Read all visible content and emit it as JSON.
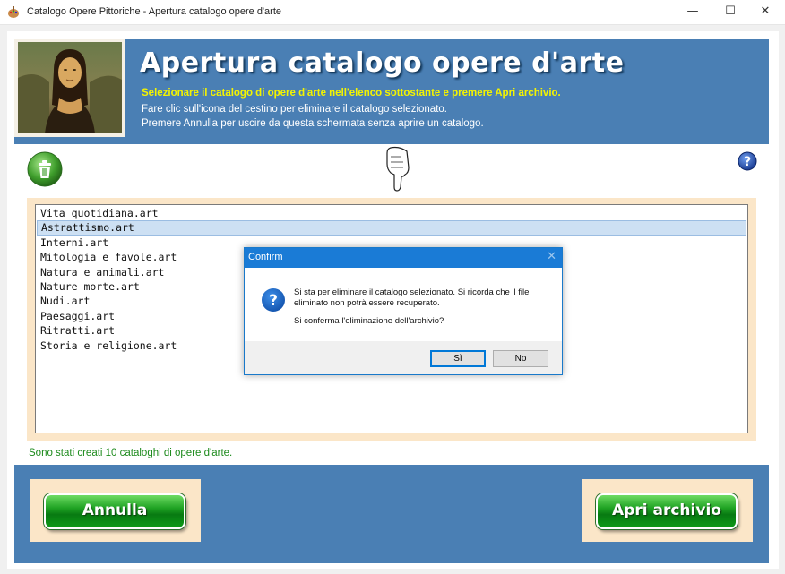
{
  "window": {
    "title": "Catalogo Opere Pittoriche - Apertura catalogo opere d'arte",
    "minimize": "—",
    "maximize": "☐",
    "close": "✕"
  },
  "header": {
    "title": "Apertura catalogo opere d'arte",
    "line1": "Selezionare il catalogo di opere d'arte nell'elenco sottostante e premere Apri archivio.",
    "line2": "Fare clic sull'icona del cestino per eliminare il catalogo selezionato.",
    "line3": "Premere Annulla per uscire da questa schermata senza aprire un catalogo."
  },
  "list": {
    "items": [
      "Vita quotidiana.art",
      "Astrattismo.art",
      "Interni.art",
      "Mitologia e favole.art",
      "Natura e animali.art",
      "Nature morte.art",
      "Nudi.art",
      "Paesaggi.art",
      "Ritratti.art",
      "Storia e religione.art"
    ],
    "selected_index": 1
  },
  "status": "Sono stati creati 10 cataloghi di opere d'arte.",
  "buttons": {
    "cancel": "Annulla",
    "open": "Apri archivio"
  },
  "dialog": {
    "title": "Confirm",
    "close": "✕",
    "message_line1": "Si sta per eliminare il catalogo selezionato. Si ricorda che il file",
    "message_line2": "eliminato non potrà essere recuperato.",
    "message_line3": "Si conferma l'eliminazione dell'archivio?",
    "yes": "Sì",
    "no": "No"
  },
  "icons": {
    "app": "palette-icon",
    "delete": "trash-icon",
    "pointer": "pointing-hand-icon",
    "help": "help-icon",
    "question": "question-icon"
  },
  "colors": {
    "header_bg": "#4a7fb4",
    "accent_yellow": "#f4f400",
    "panel_bg": "#fbe6c8",
    "status_green": "#1c8a1c",
    "dialog_title_bg": "#1a7bd6"
  }
}
